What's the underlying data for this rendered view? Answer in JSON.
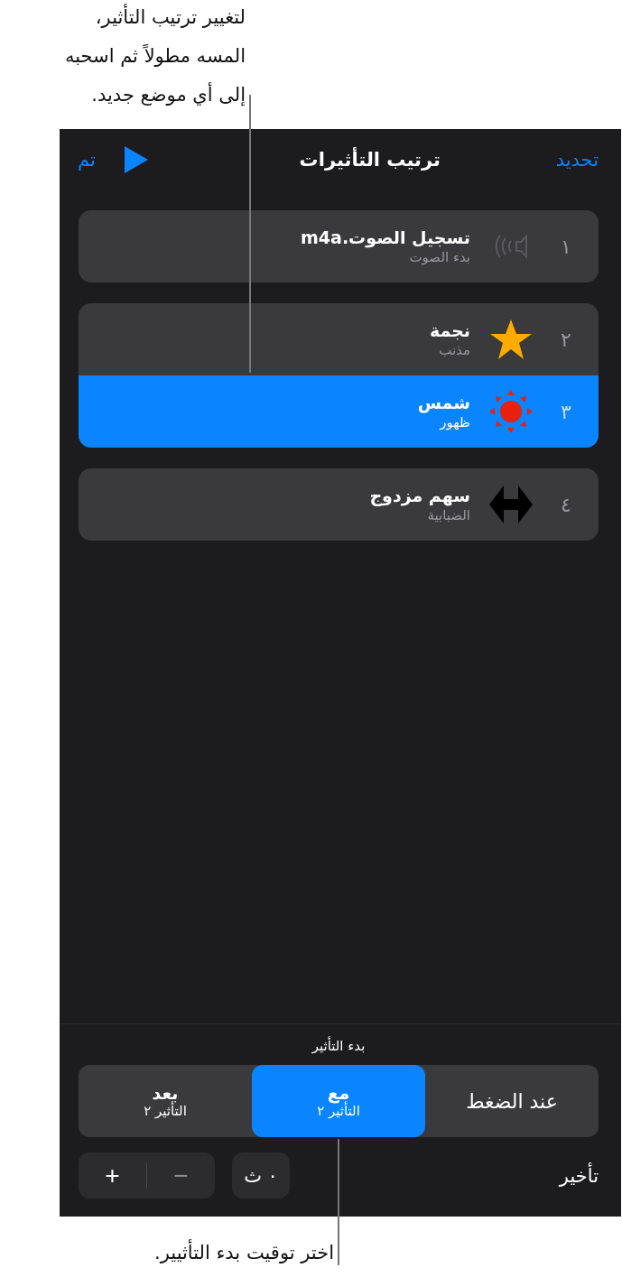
{
  "top_callout": {
    "lines": [
      "لتغيير ترتيب التأثير،",
      "المسه مطولاً ثم اسحبه",
      "إلى أي موضع جديد."
    ]
  },
  "header": {
    "select": "تحديد",
    "title": "ترتيب التأثيرات",
    "done": "تم"
  },
  "cards": [
    {
      "rows": [
        {
          "number": "١",
          "kind": "sound",
          "title": "تسجيل الصوت.m4a",
          "subtitle": "بدء الصوت",
          "selected": false
        }
      ]
    },
    {
      "rows": [
        {
          "number": "٢",
          "kind": "star",
          "title": "نجمة",
          "subtitle": "مذنب",
          "selected": false
        },
        {
          "number": "٣",
          "kind": "sun",
          "title": "شمس",
          "subtitle": "ظهور",
          "selected": true
        }
      ]
    },
    {
      "rows": [
        {
          "number": "٤",
          "kind": "double-arrow",
          "title": "سهم مزدوج",
          "subtitle": "الضبابية",
          "selected": false
        }
      ]
    }
  ],
  "start": {
    "label": "بدء التأثير",
    "segments": [
      {
        "label": "عند الضغط",
        "selected": false
      },
      {
        "label": "مع",
        "sublabel": "التأثير ٢",
        "selected": true
      },
      {
        "label": "بعد",
        "sublabel": "التأثير ٢",
        "selected": false
      }
    ]
  },
  "delay": {
    "label": "تأخير",
    "value": "٠ ث",
    "minus": "−",
    "plus": "+"
  },
  "bottom_callout": "اختر توقيت بدء التأثيير."
}
